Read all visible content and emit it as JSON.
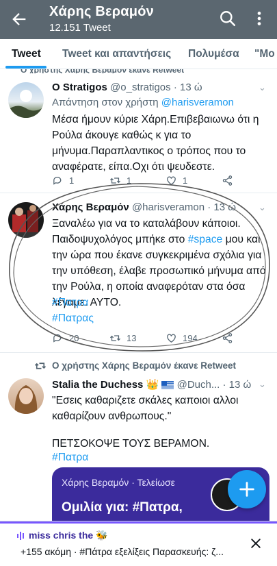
{
  "header": {
    "title": "Χάρης Βεραμόν",
    "subtitle": "12.151 Tweet"
  },
  "tabs": [
    {
      "label": "Tweet",
      "active": true
    },
    {
      "label": "Tweet και απαντήσεις",
      "active": false
    },
    {
      "label": "Πολυμέσα",
      "active": false
    },
    {
      "label": "\"Μο",
      "active": false
    }
  ],
  "top_social_context": "Ο χρήστης Χάρης Βεραμόν έκανε Retweet",
  "tweets": [
    {
      "name": "O Stratigos",
      "handle": "@o_stratigos",
      "time": "· 13 ώ",
      "reply_prefix": "Απάντηση στον χρήστη ",
      "reply_mention": "@harisveramon",
      "body": "Μέσα ήμουν κύριε Χάρη.Επιβεβαιωνω ότι η Ρούλα άκουγε καθώς κ για το μήνυμα.Παραπλαντικος ο τρόπος που το αναφέρατε, είπα.Οχι ότι ψευδεστε.",
      "replies": "1",
      "retweets": "1",
      "likes": "1"
    },
    {
      "name": "Χάρης Βεραμόν",
      "handle": "@harisveramon",
      "time": "· 13 ώ",
      "body_before": "Ξαναλέω για να το καταλάβουν κάποιοι. Παιδοψυχολόγος μπήκε στο ",
      "body_hashtag": "#space",
      "body_after": " μου και την ώρα που έκανε συγκεκριμένα σχόλια για την υπόθεση, έλαβε προσωπικό μήνυμα από την Ρούλα, η οποία αναφερόταν στα όσα λέγαμε. ΑΥΤΟ.",
      "hashtag1": "#Πατρα",
      "hashtag2": "#Πατρας",
      "replies": "20",
      "retweets": "13",
      "likes": "194"
    },
    {
      "social_context": "Ο χρήστης Χάρης Βεραμόν έκανε Retweet",
      "name": "Stalia the Duchess",
      "handle": "@Duch...",
      "time": "· 13 ώ",
      "line1": "\"Εσεις καθαριζετε σκάλες καποιοι αλλοι καθαρίζουν ανθρωπους.\"",
      "line2": "ΠΕΤΣΟΚΟΨΕ ΤΟΥΣ ΒΕΡΑΜΟΝ.",
      "hashtag": "#Πατρα"
    }
  ],
  "space_card": {
    "host": "Χάρης Βεραμόν · Τελείωσε",
    "title": "Ομιλία για: #Πατρα,"
  },
  "docked_space": {
    "title": "miss chris the 🐝",
    "subtitle": "+155 ακόμη · #Πάτρα εξελίξεις Παρασκευής: ζ..."
  },
  "colors": {
    "accent": "#1d9bf0",
    "header_bg": "#5b6770",
    "space_card": "#3b2b9c"
  }
}
